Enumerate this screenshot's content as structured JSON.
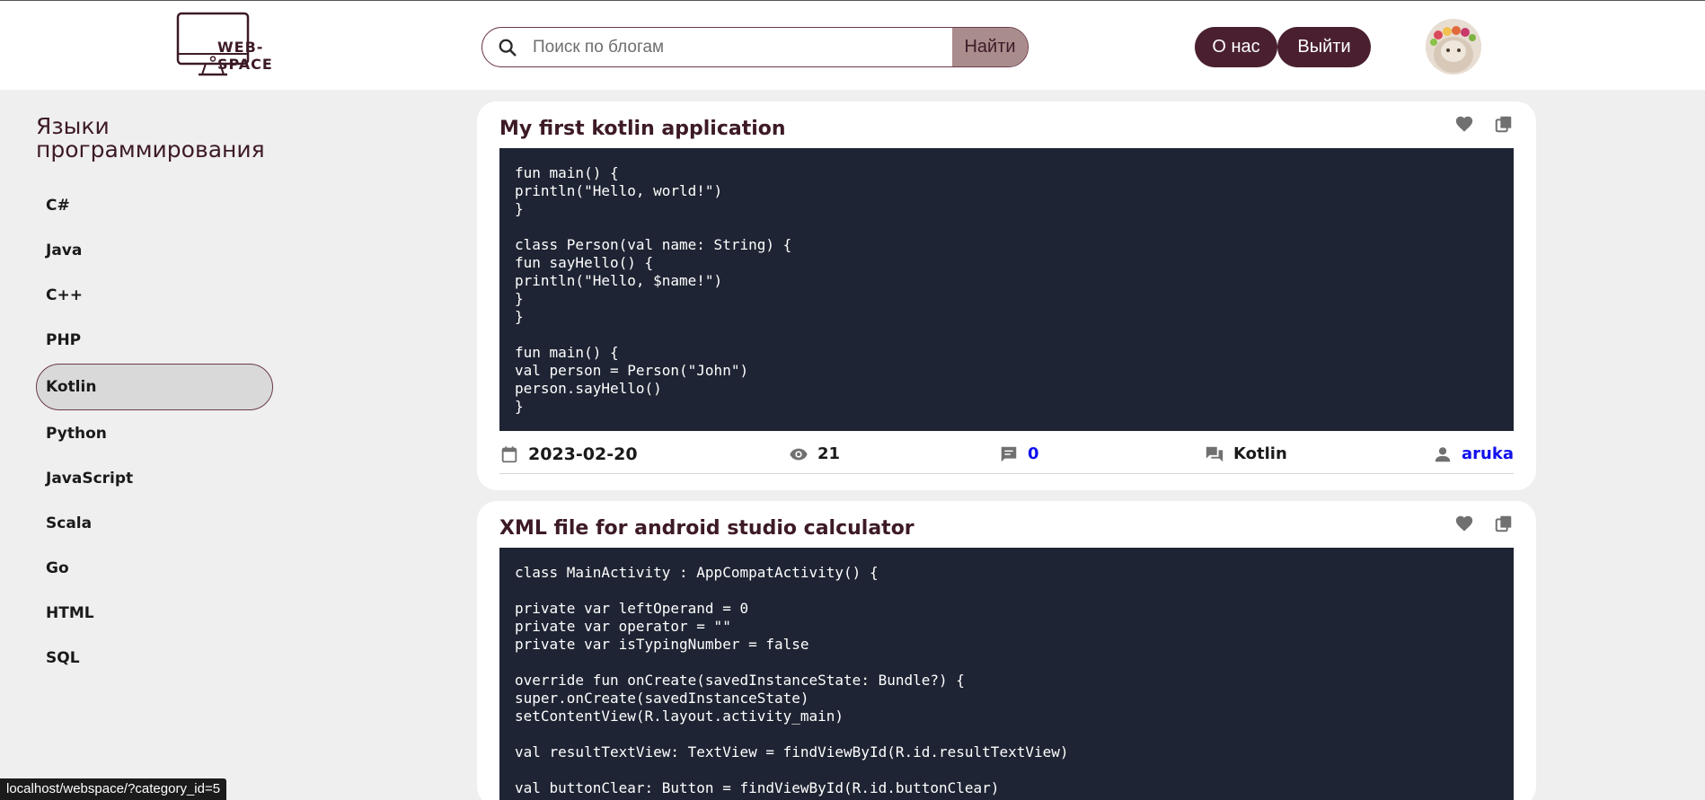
{
  "header": {
    "logo_text": "WEB-SPACE",
    "search": {
      "placeholder": "Поиск по блогам",
      "value": "",
      "button_label": "Найти"
    },
    "nav": {
      "about_label": "О нас",
      "logout_label": "Выйти"
    },
    "avatar_icon": "cat-avatar"
  },
  "sidebar": {
    "title": "Языки программирования",
    "items": [
      {
        "label": "C#",
        "active": false
      },
      {
        "label": "Java",
        "active": false
      },
      {
        "label": "C++",
        "active": false
      },
      {
        "label": "PHP",
        "active": false
      },
      {
        "label": "Kotlin",
        "active": true
      },
      {
        "label": "Python",
        "active": false
      },
      {
        "label": "JavaScript",
        "active": false
      },
      {
        "label": "Scala",
        "active": false
      },
      {
        "label": "Go",
        "active": false
      },
      {
        "label": "HTML",
        "active": false
      },
      {
        "label": "SQL",
        "active": false
      }
    ]
  },
  "posts": [
    {
      "title": "My first kotlin application",
      "code": "fun main() {\nprintln(\"Hello, world!\")\n}\n\nclass Person(val name: String) {\nfun sayHello() {\nprintln(\"Hello, $name!\")\n}\n}\n\nfun main() {\nval person = Person(\"John\")\nperson.sayHello()\n}",
      "date": "2023-02-20",
      "views": "21",
      "comments": "0",
      "category": "Kotlin",
      "author": "aruka"
    },
    {
      "title": "XML file for android studio calculator",
      "code": "class MainActivity : AppCompatActivity() {\n\nprivate var leftOperand = 0\nprivate var operator = \"\"\nprivate var isTypingNumber = false\n\noverride fun onCreate(savedInstanceState: Bundle?) {\nsuper.onCreate(savedInstanceState)\nsetContentView(R.layout.activity_main)\n\nval resultTextView: TextView = findViewById(R.id.resultTextView)\n\nval buttonClear: Button = findViewById(R.id.buttonClear)\nbuttonClear.setOnClickListener {"
    }
  ],
  "icons": {
    "like": "heart-icon",
    "copy": "copy-icon",
    "date": "calendar-icon",
    "views": "eye-icon",
    "comments": "comment-icon",
    "category": "forum-icon",
    "author": "user-icon",
    "search": "search-icon"
  },
  "colors": {
    "accent": "#4a2030",
    "search_button": "#a98d8d",
    "code_bg": "#1e2433",
    "page_bg": "#efefef",
    "link": "#1010ee"
  },
  "status_bar": {
    "url": "localhost/webspace/?category_id=5"
  }
}
